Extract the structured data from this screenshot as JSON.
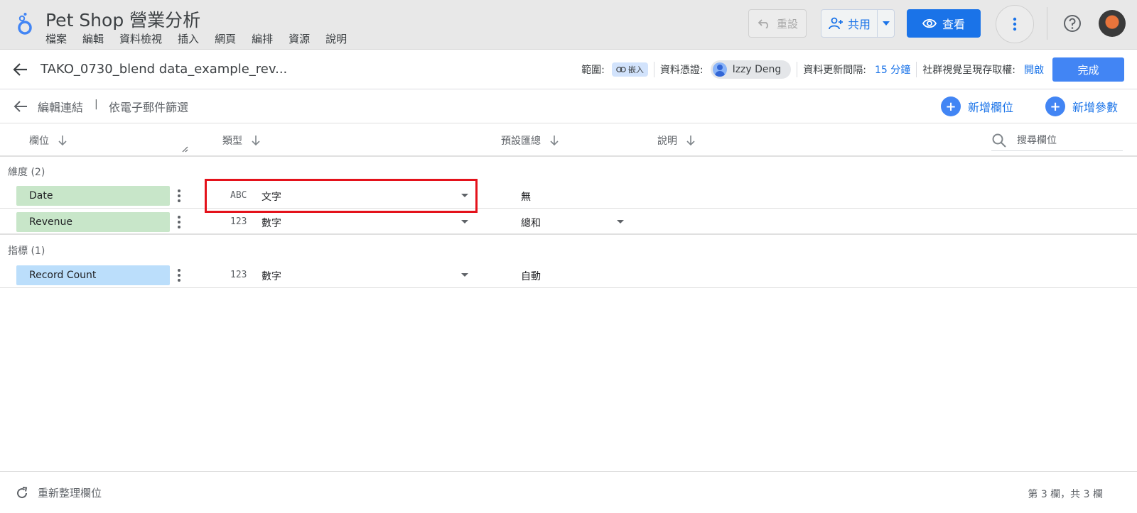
{
  "app": {
    "title": "Pet Shop 營業分析",
    "menu": [
      "檔案",
      "編輯",
      "資料檢視",
      "插入",
      "網頁",
      "編排",
      "資源",
      "說明"
    ],
    "reset_label": "重設",
    "share_label": "共用",
    "view_label": "查看"
  },
  "datasource": {
    "name": "TAKO_0730_blend data_example_rev...",
    "scope_label": "範圍:",
    "embed_label": "嵌入",
    "credentials_label": "資料憑證:",
    "user": "Izzy Deng",
    "refresh_label": "資料更新間隔:",
    "refresh_value": "15 分鐘",
    "community_label": "社群視覺呈現存取權:",
    "community_value": "開啟",
    "done_label": "完成"
  },
  "connection": {
    "edit_label": "編輯連結",
    "separator": "|",
    "filter_label": "依電子郵件篩選",
    "add_field": "新增欄位",
    "add_param": "新增參數"
  },
  "columns": {
    "field": "欄位",
    "type": "類型",
    "aggregation": "預設匯總",
    "description": "說明",
    "search_placeholder": "搜尋欄位"
  },
  "dimensions": {
    "label": "維度 (2)",
    "rows": [
      {
        "name": "Date",
        "type_icon": "ABC",
        "type": "文字",
        "aggregation": "無"
      },
      {
        "name": "Revenue",
        "type_icon": "123",
        "type": "數字",
        "aggregation": "總和"
      }
    ]
  },
  "metrics": {
    "label": "指標 (1)",
    "rows": [
      {
        "name": "Record Count",
        "type_icon": "123",
        "type": "數字",
        "aggregation": "自動"
      }
    ]
  },
  "footer": {
    "refresh_label": "重新整理欄位",
    "count": "第 3 欄，共 3 欄"
  },
  "colors": {
    "primary": "#1a73e8",
    "dimension": "#c8e6c9",
    "metric": "#bbdefb",
    "highlight": "#e4121b"
  }
}
